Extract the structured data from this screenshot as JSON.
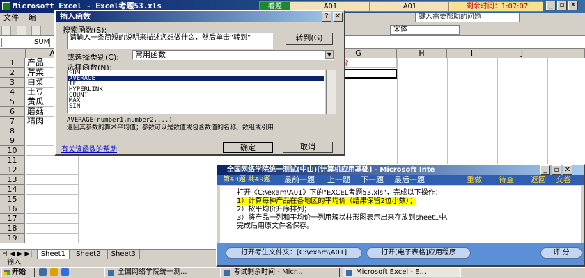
{
  "excel": {
    "title": "Microsoft Excel - Excel考题53.xls",
    "menu": [
      "文件",
      "编"
    ],
    "help_placeholder": "键入需要帮助的问题",
    "font_box": "宋体",
    "name_box": "SUM",
    "columns": [
      "A",
      "G",
      "H",
      "I",
      "J"
    ],
    "g1_text": "平均价",
    "g2_text": "=",
    "rows": [
      {
        "num": "1",
        "a": "产品"
      },
      {
        "num": "2",
        "a": "芹菜"
      },
      {
        "num": "3",
        "a": "白菜"
      },
      {
        "num": "4",
        "a": "土豆"
      },
      {
        "num": "5",
        "a": "黄瓜"
      },
      {
        "num": "6",
        "a": "蘑菇"
      },
      {
        "num": "7",
        "a": "精肉"
      },
      {
        "num": "8",
        "a": ""
      },
      {
        "num": "9",
        "a": ""
      },
      {
        "num": "10",
        "a": ""
      },
      {
        "num": "11",
        "a": ""
      },
      {
        "num": "12",
        "a": ""
      },
      {
        "num": "13",
        "a": ""
      },
      {
        "num": "14",
        "a": ""
      },
      {
        "num": "15",
        "a": ""
      },
      {
        "num": "16",
        "a": ""
      },
      {
        "num": "17",
        "a": ""
      },
      {
        "num": "18",
        "a": ""
      },
      {
        "num": "19",
        "a": ""
      }
    ],
    "sheet_nav": "H ◀ ▶ ▶|",
    "sheets": [
      "Sheet1",
      "Sheet2",
      "Sheet3"
    ],
    "status": "输入"
  },
  "exam_bar": {
    "watch": "看题",
    "cell1": "A01",
    "cell2": "A01",
    "timer": "剩余时间：1:07:07"
  },
  "dialog": {
    "title": "插入函数",
    "search_label": "搜索函数(S):",
    "search_text": "请输入一条简短的说明来描述您想做什么，然后单击“转到”",
    "goto": "转到(G)",
    "category_label": "或选择类别(C):",
    "category": "常用函数",
    "select_label": "选择函数(N):",
    "functions": [
      "SUM",
      "AVERAGE",
      "IF",
      "HYPERLINK",
      "COUNT",
      "MAX",
      "SIN"
    ],
    "syntax": "AVERAGE(number1,number2,...)",
    "desc": "返回其参数的算术平均值；参数可以是数值或包含数值的名称、数组或引用",
    "help_link": "有关该函数的帮助",
    "ok": "确定",
    "cancel": "取消"
  },
  "task_window": {
    "title": "全国网络学院统一测试(中山)[计算机应用基础] - Microsoft Inte",
    "nav": {
      "progress": "第43题 共49题",
      "first": "最前一题",
      "prev": "上一题",
      "next": "下一题",
      "last": "最后一题",
      "redo": "重做",
      "pending": "待查",
      "back": "返回",
      "submit": "交卷"
    },
    "instructions": [
      "打开《C:\\exam\\A01》下的\"EXCEL考题53.xls\"，完成以下操作：",
      "1）计算每种产品在各地区的平均价（结果保留2位小数）；",
      "2）按平均价升序排列；",
      "3）将产品一列和平均价一列用簇状柱形图表示出来存放到sheet1中。",
      "完成后用原文件名保存。"
    ],
    "btn_folder": "打开考生文件夹：[C:\\exam\\A01]",
    "btn_app": "打开[电子表格]应用程序",
    "btn_grade": "评 分"
  },
  "taskbar": {
    "start": "开始",
    "items": [
      "全国网络学院统一测...",
      "考试剩余时间 - Micr...",
      "Microsoft Excel - E..."
    ]
  },
  "colors": {
    "title_blue": "#0a246a",
    "exam_green": "#1d8a2a",
    "timer_red": "#c00000",
    "highlight_yellow": "#ffff00"
  }
}
